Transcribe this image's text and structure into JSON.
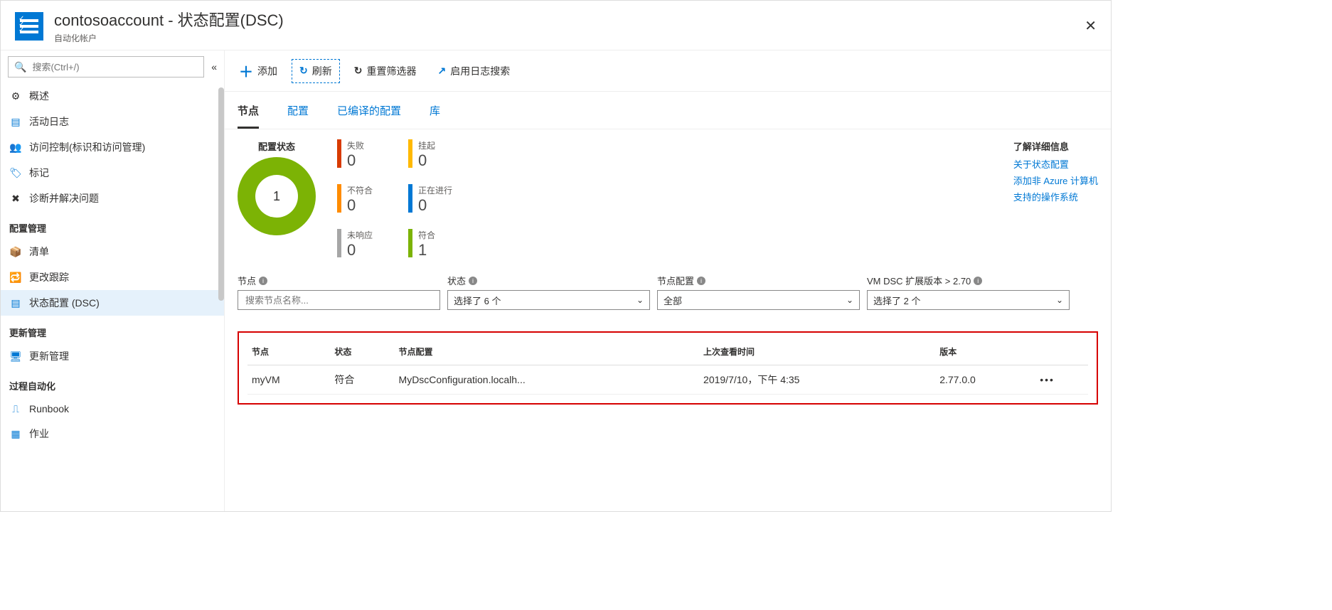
{
  "header": {
    "title": "contosoaccount - 状态配置(DSC)",
    "subtitle": "自动化帐户"
  },
  "sidebar": {
    "search_placeholder": "搜索(Ctrl+/)",
    "items": [
      {
        "icon": "overview",
        "label": "概述"
      },
      {
        "icon": "activity",
        "label": "活动日志"
      },
      {
        "icon": "access",
        "label": "访问控制(标识和访问管理)"
      },
      {
        "icon": "tag",
        "label": "标记"
      },
      {
        "icon": "diagnose",
        "label": "诊断并解决问题"
      }
    ],
    "sections": [
      {
        "title": "配置管理",
        "items": [
          {
            "icon": "inventory",
            "label": "清单"
          },
          {
            "icon": "change",
            "label": "更改跟踪"
          },
          {
            "icon": "dsc",
            "label": "状态配置 (DSC)",
            "active": true
          }
        ]
      },
      {
        "title": "更新管理",
        "items": [
          {
            "icon": "update",
            "label": "更新管理"
          }
        ]
      },
      {
        "title": "过程自动化",
        "items": [
          {
            "icon": "runbook",
            "label": "Runbook"
          },
          {
            "icon": "jobs",
            "label": "作业"
          }
        ]
      }
    ]
  },
  "toolbar": {
    "add": "添加",
    "refresh": "刷新",
    "reset_filter": "重置筛选器",
    "enable_log": "启用日志搜索"
  },
  "tabs": [
    "节点",
    "配置",
    "已编译的配置",
    "库"
  ],
  "status": {
    "donut_title": "配置状态",
    "donut_value": "1",
    "stats": {
      "failed": {
        "label": "失败",
        "value": "0"
      },
      "noncompliant": {
        "label": "不符合",
        "value": "0"
      },
      "noresponse": {
        "label": "未响应",
        "value": "0"
      },
      "pending": {
        "label": "挂起",
        "value": "0"
      },
      "inprogress": {
        "label": "正在进行",
        "value": "0"
      },
      "compliant": {
        "label": "符合",
        "value": "1"
      }
    }
  },
  "learn_more": {
    "title": "了解详细信息",
    "links": [
      "关于状态配置",
      "添加非 Azure 计算机",
      "支持的操作系统"
    ]
  },
  "filters": {
    "node": {
      "label": "节点",
      "placeholder": "搜索节点名称..."
    },
    "state": {
      "label": "状态",
      "value": "选择了 6 个"
    },
    "node_config": {
      "label": "节点配置",
      "value": "全部"
    },
    "vm_dsc": {
      "label": "VM DSC 扩展版本 > 2.70",
      "value": "选择了 2 个"
    }
  },
  "table": {
    "headers": [
      "节点",
      "状态",
      "节点配置",
      "上次查看时间",
      "版本"
    ],
    "rows": [
      {
        "node": "myVM",
        "state": "符合",
        "config": "MyDscConfiguration.localh...",
        "last_seen": "2019/7/10，下午 4:35",
        "version": "2.77.0.0"
      }
    ]
  }
}
